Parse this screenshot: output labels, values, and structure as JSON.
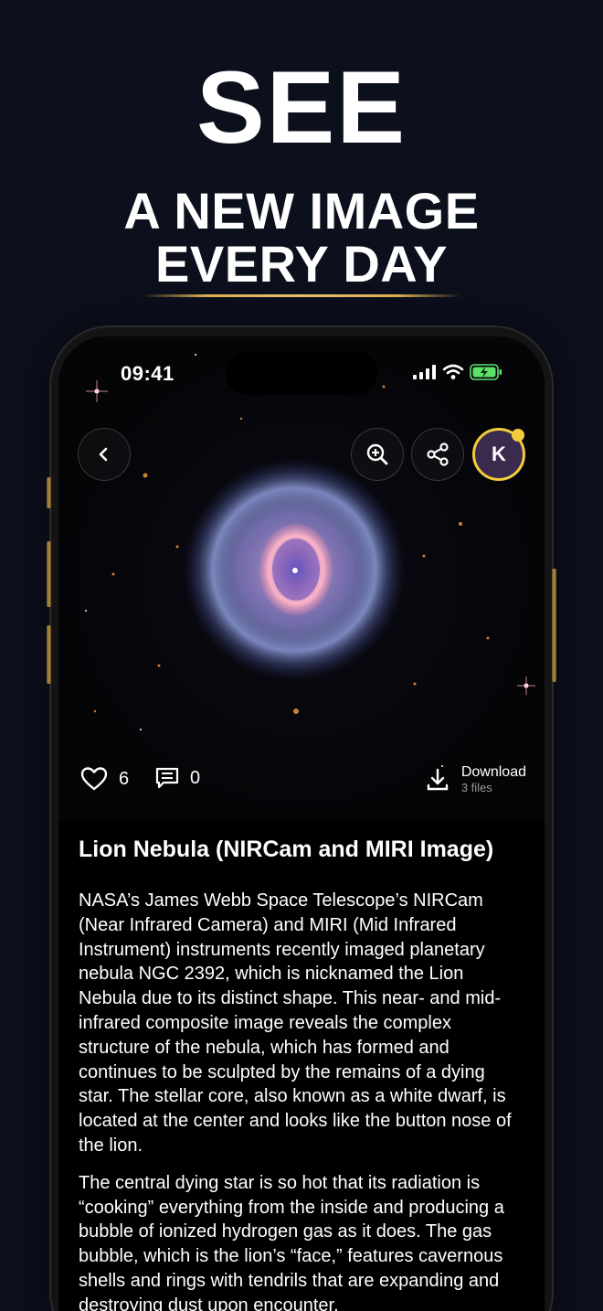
{
  "hero": {
    "see": "SEE",
    "line1": "A NEW IMAGE",
    "line2": "EVERY DAY"
  },
  "status_bar": {
    "time": "09:41"
  },
  "avatar": {
    "initial": "K"
  },
  "stats": {
    "likes": "6",
    "comments": "0"
  },
  "download": {
    "label": "Download",
    "files": "3 files"
  },
  "article": {
    "title": "Lion Nebula (NIRCam and MIRI Image)",
    "paragraphs": [
      "NASA’s James Webb Space Telescope’s NIRCam (Near Infrared Camera) and MIRI (Mid Infrared Instrument) instruments recently imaged planetary nebula NGC 2392, which is nicknamed the Lion Nebula due to its distinct shape. This near- and mid-infrared composite image reveals the complex structure of the nebula, which has formed and continues to be sculpted by the remains of a dying star. The stellar core, also known as a white dwarf, is located at the center and looks like the button nose of the lion.",
      "The central dying star is so hot that its radiation is “cooking” everything from the inside and producing a bubble of ionized hydrogen gas as it does. The gas bubble, which is the lion’s “face,” features cavernous shells and rings with tendrils that are expanding and destroying dust upon encounter."
    ]
  },
  "colors": {
    "background": "#0c0f1c",
    "gold": "#e0b253",
    "avatar_ring": "#f3cc3c",
    "battery": "#5ee06a"
  },
  "icons": [
    "back-chevron-icon",
    "zoom-in-icon",
    "share-icon",
    "heart-icon",
    "comment-icon",
    "download-icon",
    "signal-icon",
    "wifi-icon",
    "battery-icon"
  ]
}
